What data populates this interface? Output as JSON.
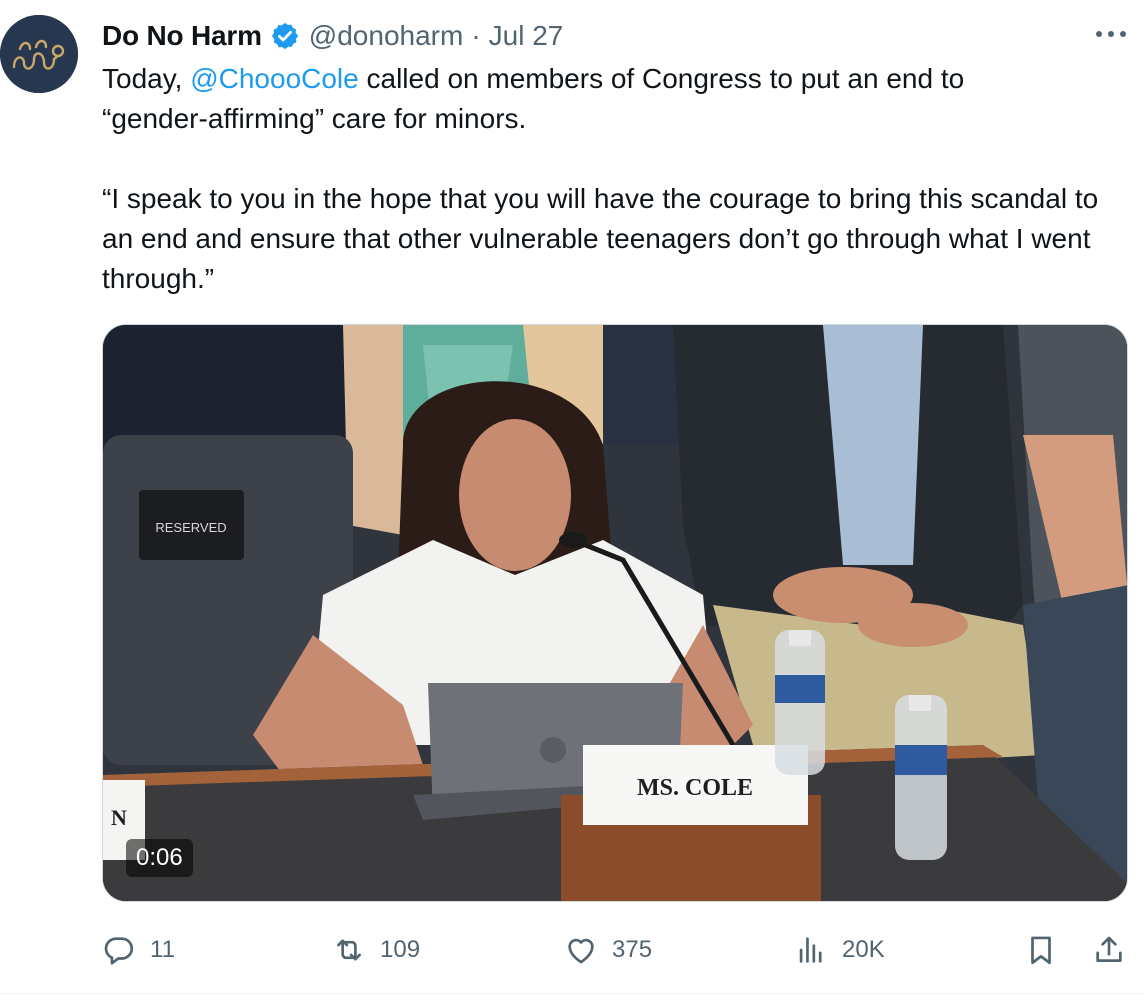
{
  "tweet": {
    "author": {
      "name": "Do No Harm",
      "handle": "@donoharm",
      "separator": "·",
      "date": "Jul 27",
      "verified": true,
      "avatar_bg": "#27374f",
      "avatar_icon": "stethoscope-logo-icon"
    },
    "text": {
      "line1_before": "Today, ",
      "mention": "@ChoooCole",
      "line1_after": " called on members of Congress to put an end to",
      "line2": "“gender-affirming” care for minors.",
      "quote": "“I speak to you in the hope that you will have the courage to bring this scandal to an end and ensure that other vulnerable teenagers don’t go through what I went through.”"
    },
    "media": {
      "type": "video",
      "timestamp": "0:06",
      "reserved_sign": "RESERVED",
      "nameplate": "MS. COLE",
      "left_nameplate_fragment": "N"
    },
    "actions": {
      "replies": "11",
      "retweets": "109",
      "likes": "375",
      "views": "20K"
    },
    "colors": {
      "accent": "#1d9bf0",
      "secondary_text": "#536471",
      "primary_text": "#0f1419"
    }
  }
}
